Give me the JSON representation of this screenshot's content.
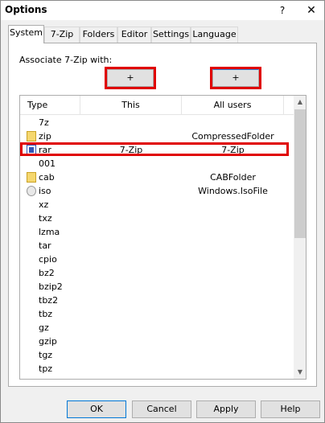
{
  "window": {
    "title": "Options",
    "help_label": "?",
    "close_label": "✕"
  },
  "tabs": [
    {
      "label": "System"
    },
    {
      "label": "7-Zip"
    },
    {
      "label": "Folders"
    },
    {
      "label": "Editor"
    },
    {
      "label": "Settings"
    },
    {
      "label": "Language"
    }
  ],
  "system": {
    "associate_label": "Associate 7-Zip with:",
    "plus_button_1": "+",
    "plus_button_2": "+",
    "columns": {
      "type": "Type",
      "this": "This",
      "all_users": "All users"
    },
    "rows": [
      {
        "ext": "7z",
        "this": "",
        "all": "",
        "icon": ""
      },
      {
        "ext": "zip",
        "this": "",
        "all": "CompressedFolder",
        "icon": "zip-folder-icon"
      },
      {
        "ext": "rar",
        "this": "7-Zip",
        "all": "7-Zip",
        "icon": "winrar-icon"
      },
      {
        "ext": "001",
        "this": "",
        "all": "",
        "icon": ""
      },
      {
        "ext": "cab",
        "this": "",
        "all": "CABFolder",
        "icon": "cab-folder-icon"
      },
      {
        "ext": "iso",
        "this": "",
        "all": "Windows.IsoFile",
        "icon": "disc-icon"
      },
      {
        "ext": "xz",
        "this": "",
        "all": "",
        "icon": ""
      },
      {
        "ext": "txz",
        "this": "",
        "all": "",
        "icon": ""
      },
      {
        "ext": "lzma",
        "this": "",
        "all": "",
        "icon": ""
      },
      {
        "ext": "tar",
        "this": "",
        "all": "",
        "icon": ""
      },
      {
        "ext": "cpio",
        "this": "",
        "all": "",
        "icon": ""
      },
      {
        "ext": "bz2",
        "this": "",
        "all": "",
        "icon": ""
      },
      {
        "ext": "bzip2",
        "this": "",
        "all": "",
        "icon": ""
      },
      {
        "ext": "tbz2",
        "this": "",
        "all": "",
        "icon": ""
      },
      {
        "ext": "tbz",
        "this": "",
        "all": "",
        "icon": ""
      },
      {
        "ext": "gz",
        "this": "",
        "all": "",
        "icon": ""
      },
      {
        "ext": "gzip",
        "this": "",
        "all": "",
        "icon": ""
      },
      {
        "ext": "tgz",
        "this": "",
        "all": "",
        "icon": ""
      },
      {
        "ext": "tpz",
        "this": "",
        "all": "",
        "icon": ""
      }
    ]
  },
  "footer": {
    "ok": "OK",
    "cancel": "Cancel",
    "apply": "Apply",
    "help": "Help"
  },
  "colors": {
    "highlight": "#e00000",
    "accent": "#0078d7"
  }
}
